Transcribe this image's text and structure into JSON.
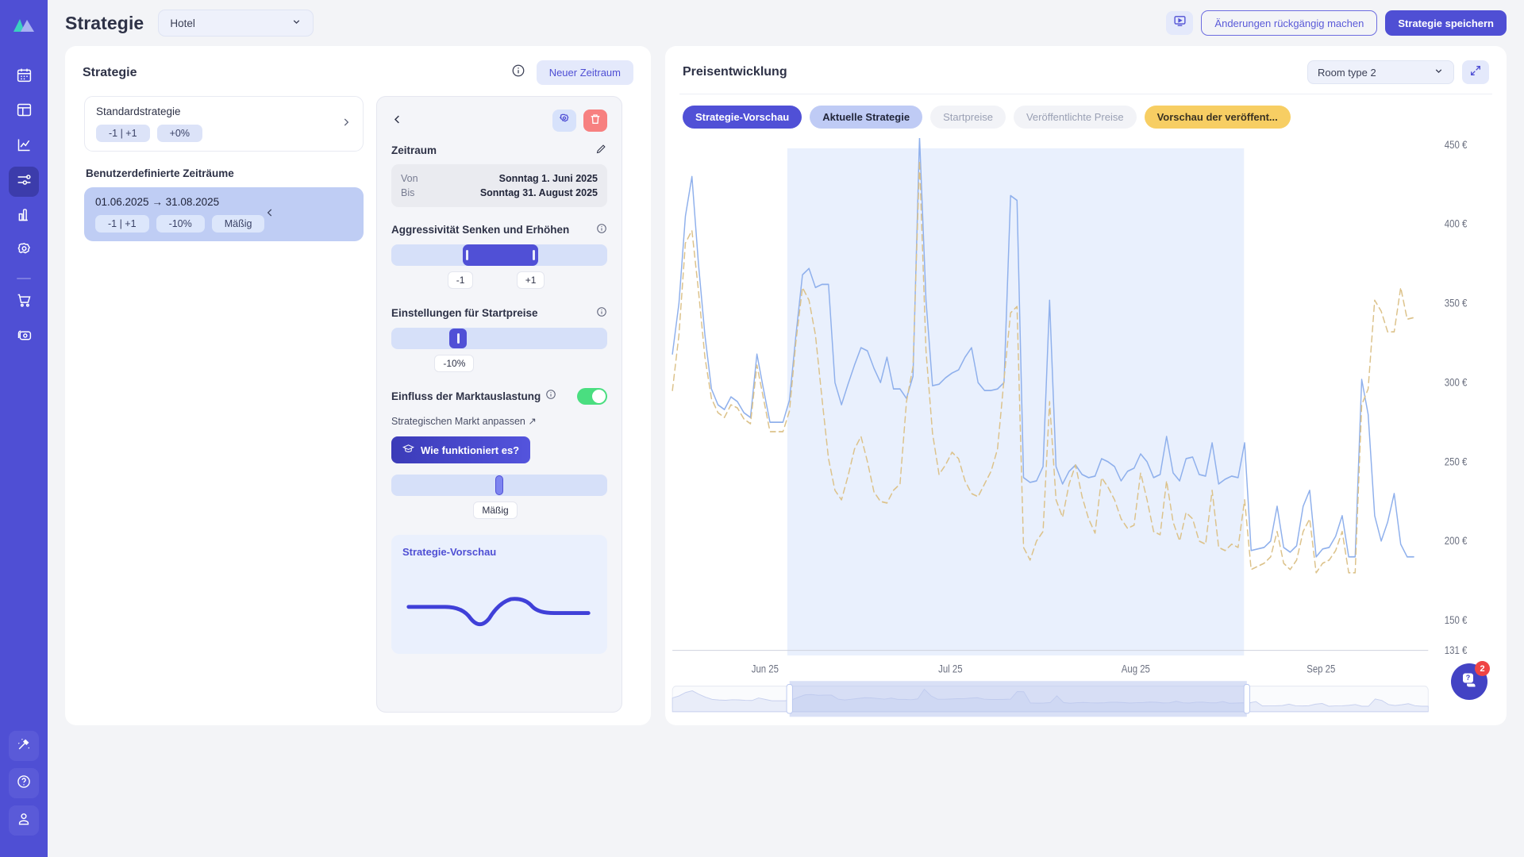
{
  "sidebar": {
    "logo_icon": "mountain-logo-icon",
    "items": [
      {
        "icon": "calendar-icon",
        "active": false
      },
      {
        "icon": "dashboard-layout-icon",
        "active": false
      },
      {
        "icon": "line-chart-icon",
        "active": false
      },
      {
        "icon": "sliders-icon",
        "active": true
      },
      {
        "icon": "analytics-bars-icon",
        "active": false
      },
      {
        "icon": "gear-icon",
        "active": false
      }
    ],
    "items_lower": [
      {
        "icon": "shopping-cart-icon"
      },
      {
        "icon": "money-card-icon"
      }
    ],
    "bottom_items": [
      {
        "icon": "magic-wand-icon"
      },
      {
        "icon": "help-circle-icon"
      },
      {
        "icon": "user-profile-icon"
      }
    ]
  },
  "topbar": {
    "title": "Strategie",
    "hotel_select_value": "Hotel",
    "chevron_icon": "chevron-down-icon",
    "video_icon": "video-tutorial-icon",
    "undo_label": "Änderungen rückgängig machen",
    "save_label": "Strategie speichern"
  },
  "strategy_panel": {
    "title": "Strategie",
    "info_icon": "info-circle-icon",
    "new_period_label": "Neuer Zeitraum",
    "default_strategy": {
      "name": "Standardstrategie",
      "chips": [
        "-1 | +1",
        "+0%"
      ],
      "chevron_icon": "chevron-right-icon"
    },
    "custom_section_label": "Benutzerdefinierte Zeiträume",
    "custom_periods": [
      {
        "name": "01.06.2025 → 31.08.2025",
        "chips": [
          "-1 | +1",
          "-10%",
          "Mäßig"
        ],
        "chevron_icon": "chevron-left-icon"
      }
    ]
  },
  "detail_panel": {
    "back_icon": "chevron-left-icon",
    "settings_icon": "gear-icon",
    "delete_icon": "trash-icon",
    "zeitraum_label": "Zeitraum",
    "edit_icon": "pencil-edit-icon",
    "von_label": "Von",
    "von_value": "Sonntag 1. Juni 2025",
    "bis_label": "Bis",
    "bis_value": "Sonntag 31. August 2025",
    "aggressivity_label": "Aggressivität Senken und Erhöhen",
    "aggressivity_info_icon": "info-circle-icon",
    "aggressivity_min_value": "-1",
    "aggressivity_max_value": "+1",
    "startprices_label": "Einstellungen für Startpreise",
    "startprices_info_icon": "info-circle-icon",
    "startprices_value": "-10%",
    "market_toggle_label": "Einfluss der Marktauslastung",
    "market_toggle_info_icon": "info-circle-icon",
    "market_toggle_on": true,
    "adjust_market_link": "Strategischen Markt anpassen ↗",
    "howto_label": "Wie funktioniert es?",
    "howto_icon": "graduation-cap-icon",
    "market_level_value": "Mäßig",
    "preview_title": "Strategie-Vorschau"
  },
  "chart_panel": {
    "title": "Preisentwicklung",
    "room_select_value": "Room type 2",
    "room_chevron_icon": "chevron-down-icon",
    "expand_icon": "expand-arrows-icon",
    "tabs": [
      {
        "label": "Strategie-Vorschau",
        "style": "primary"
      },
      {
        "label": "Aktuelle Strategie",
        "style": "secondary"
      },
      {
        "label": "Startpreise",
        "style": "muted"
      },
      {
        "label": "Veröffentlichte Preise",
        "style": "muted"
      },
      {
        "label": "Vorschau der veröffent...",
        "style": "amber"
      }
    ]
  },
  "help": {
    "icon": "help-chat-icon",
    "badge_count": "2"
  },
  "colors": {
    "brand": "#4f4fd4",
    "series_blue": "#8fb0ec",
    "series_gold": "#dcc28a",
    "highlight_band": "#e9f0fd",
    "amber": "#f7ce63",
    "toggle_on": "#4ade80",
    "danger": "#f78080"
  },
  "chart_data": {
    "type": "line",
    "title": "Preisentwicklung",
    "xlabel": "",
    "ylabel": "",
    "grid": false,
    "legend_position": "none",
    "ylim": [
      131,
      450
    ],
    "ytick_labels": [
      "450 €",
      "400 €",
      "350 €",
      "300 €",
      "250 €",
      "200 €",
      "150 €",
      "131 €"
    ],
    "ytick_values": [
      450,
      400,
      350,
      300,
      250,
      200,
      150,
      131
    ],
    "xtick_labels": [
      "Jun 25",
      "Jul 25",
      "Aug 25",
      "Sep 25"
    ],
    "highlight_range": [
      "2025-06-20",
      "2025-08-25"
    ],
    "series": [
      {
        "name": "Strategie-Vorschau",
        "color": "#8fb0ec",
        "style": "solid",
        "values": [
          318,
          350,
          405,
          430,
          375,
          330,
          296,
          286,
          283,
          291,
          288,
          281,
          278,
          318,
          296,
          275,
          275,
          275,
          289,
          330,
          368,
          372,
          360,
          362,
          362,
          300,
          286,
          299,
          311,
          322,
          320,
          309,
          300,
          316,
          296,
          296,
          290,
          304,
          455,
          352,
          298,
          299,
          303,
          306,
          308,
          316,
          322,
          300,
          295,
          295,
          296,
          300,
          418,
          415,
          240,
          237,
          238,
          247,
          352,
          247,
          236,
          244,
          248,
          242,
          240,
          241,
          252,
          250,
          247,
          238,
          244,
          246,
          255,
          250,
          240,
          242,
          266,
          243,
          238,
          252,
          253,
          242,
          241,
          262,
          236,
          239,
          241,
          240,
          262,
          194,
          195,
          196,
          200,
          222,
          196,
          193,
          197,
          222,
          232,
          190,
          195,
          196,
          203,
          216,
          190,
          190,
          302,
          280,
          216,
          200,
          212,
          230,
          198,
          190,
          190
        ]
      },
      {
        "name": "Aktuelle Strategie",
        "color": "#dcc28a",
        "style": "dashed",
        "values": [
          295,
          330,
          388,
          396,
          358,
          316,
          290,
          281,
          278,
          286,
          284,
          277,
          274,
          311,
          290,
          269,
          269,
          269,
          282,
          326,
          360,
          352,
          330,
          290,
          252,
          232,
          226,
          241,
          258,
          266,
          250,
          231,
          225,
          224,
          232,
          236,
          288,
          310,
          440,
          320,
          268,
          242,
          248,
          256,
          252,
          238,
          230,
          228,
          236,
          244,
          258,
          302,
          344,
          348,
          196,
          188,
          200,
          206,
          288,
          226,
          215,
          236,
          248,
          228,
          214,
          205,
          240,
          234,
          226,
          214,
          208,
          210,
          243,
          226,
          206,
          204,
          238,
          212,
          200,
          218,
          214,
          200,
          198,
          232,
          196,
          194,
          198,
          196,
          226,
          182,
          184,
          186,
          190,
          206,
          186,
          182,
          188,
          206,
          214,
          180,
          186,
          188,
          194,
          206,
          180,
          180,
          286,
          296,
          352,
          345,
          332,
          332,
          360,
          340,
          341
        ]
      }
    ],
    "brush": {
      "selection_start_fraction": 0.155,
      "selection_end_fraction": 0.46
    }
  }
}
